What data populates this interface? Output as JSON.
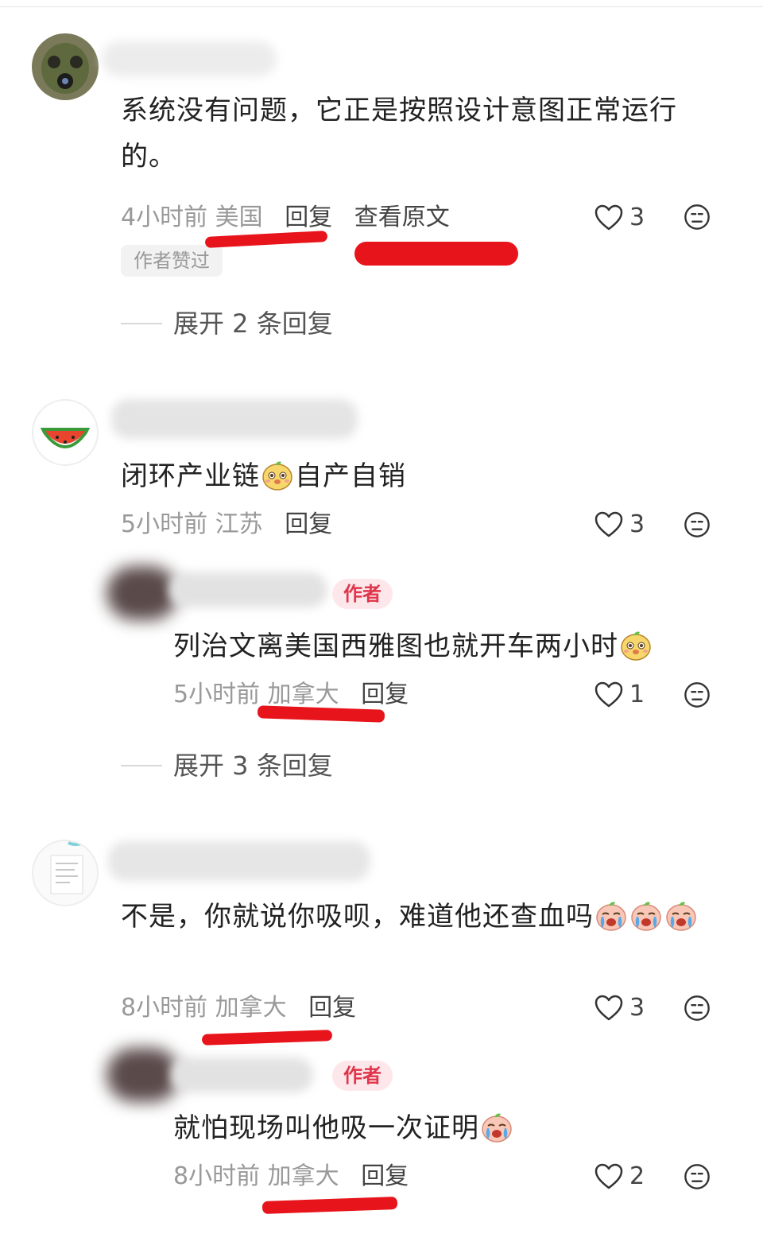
{
  "comments": [
    {
      "text": "系统没有问题，它正是按照设计意图正常运行的。",
      "time": "4小时前",
      "location": "美国",
      "reply_label": "回复",
      "view_original_label": "查看原文",
      "likes": "3",
      "badge": "作者赞过",
      "expand_label": "展开 2 条回复"
    },
    {
      "text_before": "闭环产业链",
      "text_after": "自产自销",
      "time": "5小时前",
      "location": "江苏",
      "reply_label": "回复",
      "likes": "3",
      "reply": {
        "author_badge": "作者",
        "text": "列治文离美国西雅图也就开车两小时",
        "time": "5小时前",
        "location": "加拿大",
        "reply_label": "回复",
        "likes": "1"
      },
      "expand_label": "展开 3 条回复"
    },
    {
      "text": "不是，你就说你吸呗，难道他还查血吗",
      "time": "8小时前",
      "location": "加拿大",
      "reply_label": "回复",
      "likes": "3",
      "reply": {
        "author_badge": "作者",
        "text": "就怕现场叫他吸一次证明",
        "time": "8小时前",
        "location": "加拿大",
        "reply_label": "回复",
        "likes": "2"
      }
    }
  ],
  "colors": {
    "underline": "#e8141b",
    "author_badge_bg": "#fde7ea",
    "author_badge_text": "#e0354a",
    "meta_gray": "#999999"
  },
  "icons": [
    "heart-icon",
    "dislike-face-icon",
    "watermelon-avatar",
    "cute-emoji",
    "crying-emoji"
  ]
}
